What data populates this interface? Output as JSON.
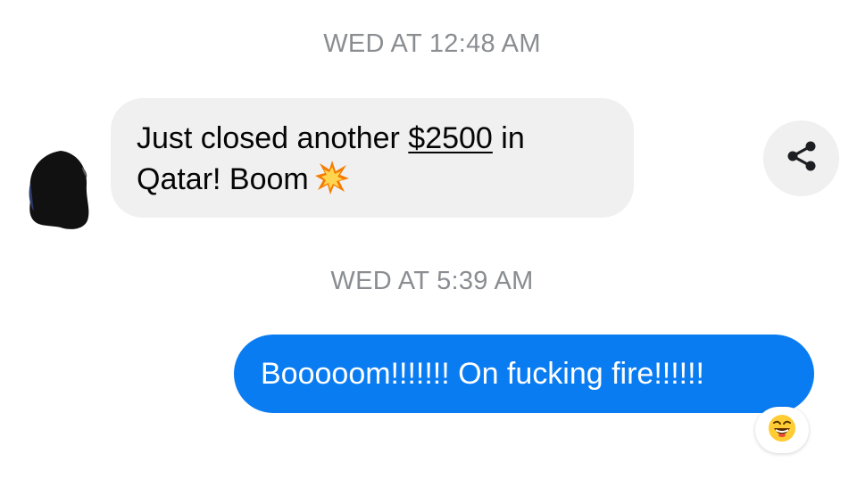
{
  "conversation": {
    "timestamp_1": "WED AT 12:48 AM",
    "incoming_message": {
      "text_before_amount": "Just closed another ",
      "amount": "$2500",
      "text_after_amount": " in Qatar! Boom",
      "emoji": "collision-icon"
    },
    "timestamp_2": "WED AT 5:39 AM",
    "outgoing_message": {
      "text": "Booooom!!!!!!! On fucking fire!!!!!!"
    },
    "reaction": {
      "emoji": "laughing-face-icon"
    }
  },
  "actions": {
    "share_icon": "share-icon"
  },
  "colors": {
    "outgoing_bubble": "#0a7cf2",
    "incoming_bubble": "#f0f0f0",
    "timestamp_text": "#8a8d91"
  }
}
